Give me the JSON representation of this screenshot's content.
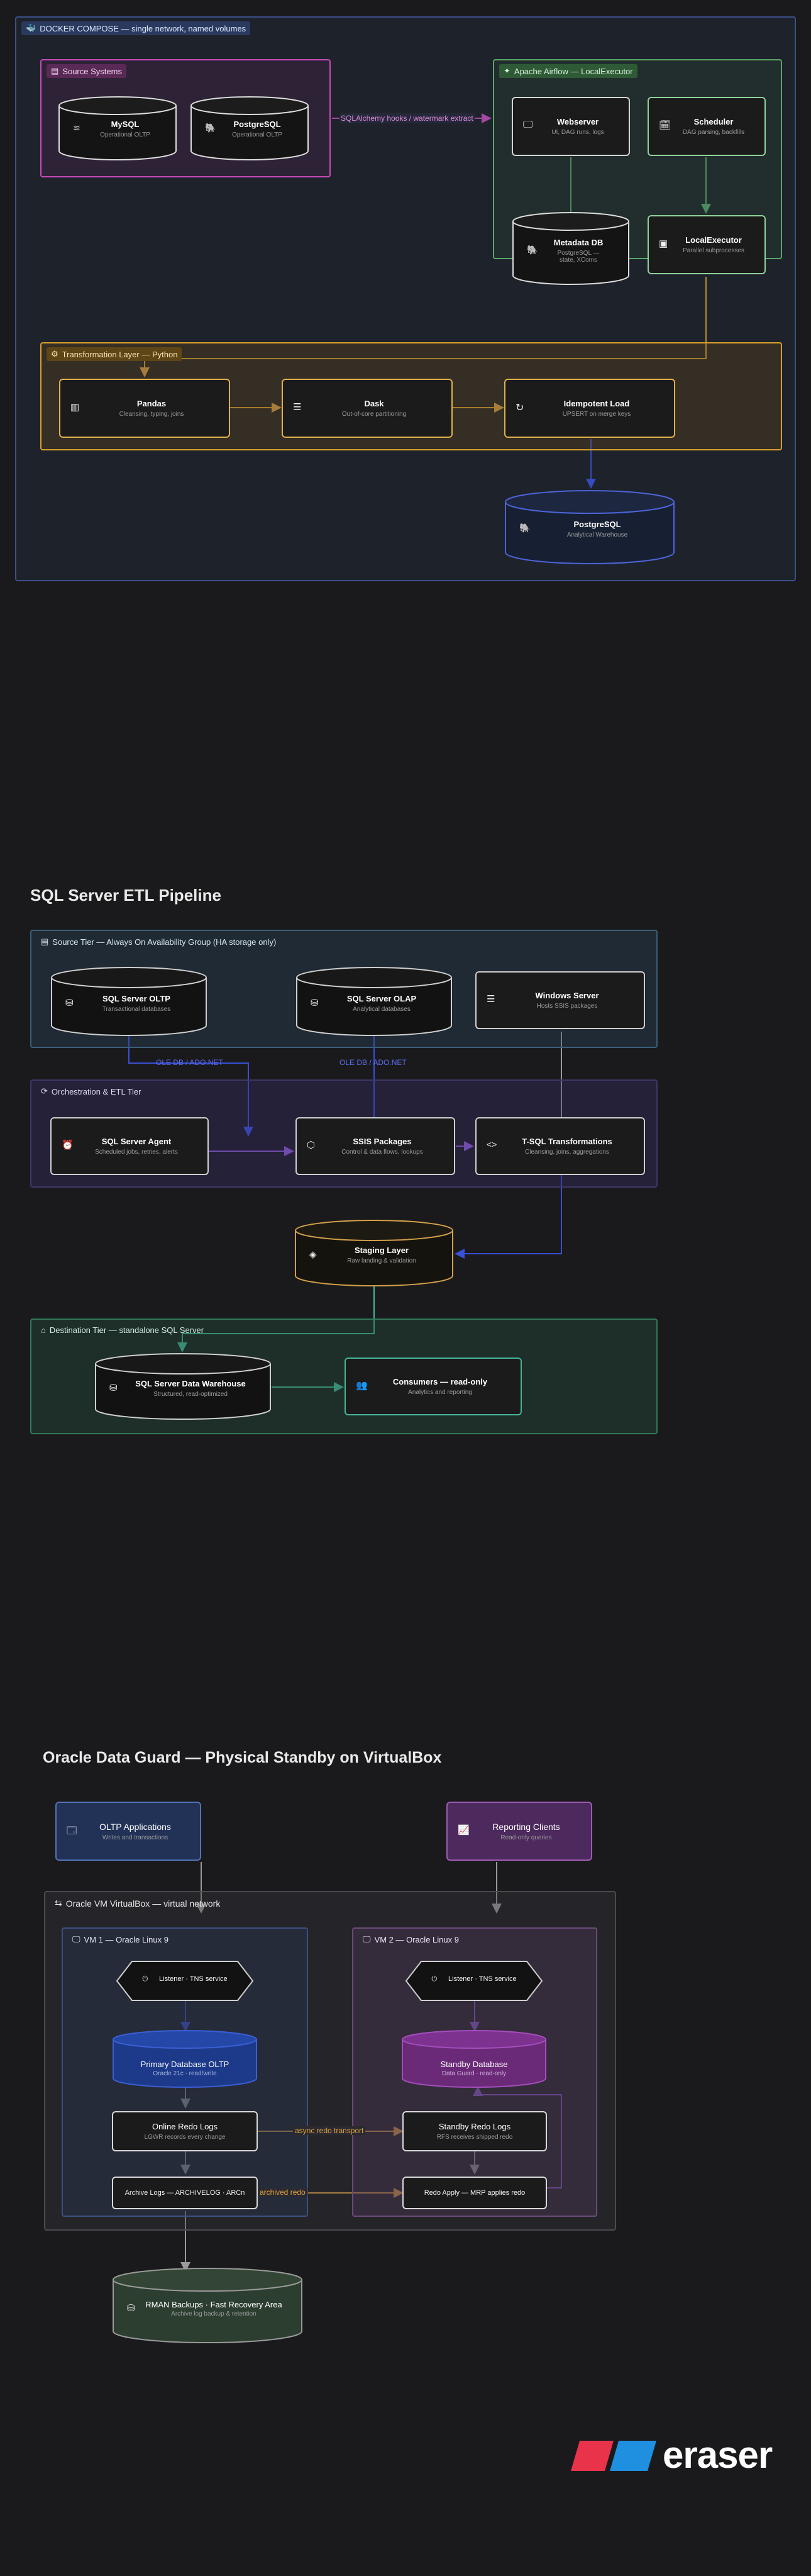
{
  "docker": {
    "title": "DOCKER COMPOSE — single network, named volumes",
    "source_group": "Source Systems",
    "airflow_group": "Apache Airflow — LocalExecutor",
    "transform_group": "Transformation Layer — Python",
    "mysql": {
      "title": "MySQL",
      "sub": "Operational OLTP"
    },
    "postgres_src": {
      "title": "PostgreSQL",
      "sub": "Operational OLTP"
    },
    "edge_extract": "SQLAlchemy hooks / watermark extract",
    "webserver": {
      "title": "Webserver",
      "sub": "UI, DAG runs, logs"
    },
    "scheduler": {
      "title": "Scheduler",
      "sub": "DAG parsing, backfills"
    },
    "metadata": {
      "title": "Metadata DB",
      "sub": "PostgreSQL — state, XComs"
    },
    "local_executor": {
      "title": "LocalExecutor",
      "sub": "Parallel subprocesses"
    },
    "pandas": {
      "title": "Pandas",
      "sub": "Cleansing, typing, joins"
    },
    "dask": {
      "title": "Dask",
      "sub": "Out-of-core partitioning"
    },
    "idempotent": {
      "title": "Idempotent Load",
      "sub": "UPSERT on merge keys"
    },
    "warehouse": {
      "title": "PostgreSQL",
      "sub": "Analytical Warehouse"
    }
  },
  "sqlserver": {
    "heading": "SQL Server ETL Pipeline",
    "source_tier": "Source Tier — Always On Availability Group (HA storage only)",
    "orch_tier": "Orchestration & ETL Tier",
    "dest_tier": "Destination Tier — standalone SQL Server",
    "oltp": {
      "title": "SQL Server OLTP",
      "sub": "Transactional databases"
    },
    "olap": {
      "title": "SQL Server OLAP",
      "sub": "Analytical databases"
    },
    "winserver": {
      "title": "Windows Server",
      "sub": "Hosts SSIS packages"
    },
    "edge_ole1": "OLE DB / ADO.NET",
    "edge_ole2": "OLE DB / ADO.NET",
    "agent": {
      "title": "SQL Server Agent",
      "sub": "Scheduled jobs, retries, alerts"
    },
    "ssis": {
      "title": "SSIS Packages",
      "sub": "Control & data flows, lookups"
    },
    "tsql": {
      "title": "T-SQL Transformations",
      "sub": "Cleansing, joins, aggregations"
    },
    "staging": {
      "title": "Staging Layer",
      "sub": "Raw landing & validation"
    },
    "dw": {
      "title": "SQL Server Data Warehouse",
      "sub": "Structured, read-optimized"
    },
    "consumers": {
      "title": "Consumers — read-only",
      "sub": "Analytics and reporting"
    }
  },
  "oracle": {
    "heading": "Oracle Data Guard — Physical Standby on VirtualBox",
    "oltp_apps": {
      "title": "OLTP Applications",
      "sub": "Writes and transactions"
    },
    "reporting": {
      "title": "Reporting Clients",
      "sub": "Read-only queries"
    },
    "vbox_group": "Oracle VM VirtualBox — virtual network",
    "vm1_group": "VM 1 — Oracle Linux 9",
    "vm2_group": "VM 2 — Oracle Linux 9",
    "listener1": "Listener · TNS service",
    "listener2": "Listener · TNS service",
    "primary": {
      "title": "Primary Database OLTP",
      "sub": "Oracle 21c · read/write"
    },
    "standby": {
      "title": "Standby Database",
      "sub": "Data Guard · read-only"
    },
    "online_redo": {
      "title": "Online Redo Logs",
      "sub": "LGWR records every change"
    },
    "standby_redo": {
      "title": "Standby Redo Logs",
      "sub": "RFS receives shipped redo"
    },
    "archive_logs": "Archive Logs — ARCHIVELOG · ARCn",
    "redo_apply": "Redo Apply — MRP applies redo",
    "edge_async": "async redo transport",
    "edge_archived": "archived redo",
    "rman": {
      "title": "RMAN Backups · Fast Recovery Area",
      "sub": "Archive log backup & retention"
    }
  },
  "brand": {
    "name": "eraser"
  },
  "colors": {
    "source": "#c64bb8",
    "airflow": "#5aa866",
    "transform": "#d9a02a",
    "blue": "#3a4fd6",
    "green": "#46b59c",
    "purple": "#7c4dbf",
    "orange": "#e0a040"
  }
}
